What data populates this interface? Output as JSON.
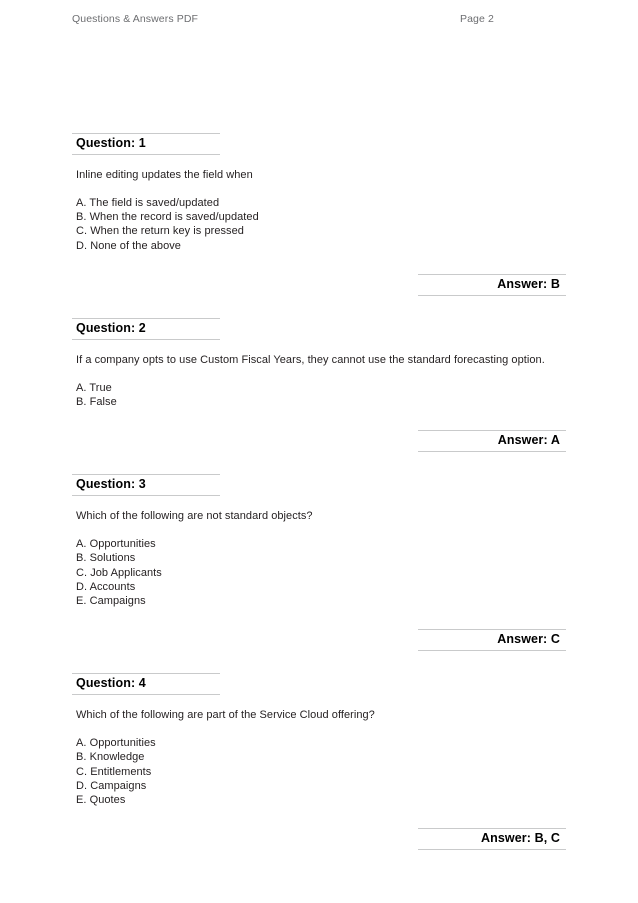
{
  "header": {
    "left_text": "Questions & Answers PDF",
    "right_text": "Page 2"
  },
  "questions": [
    {
      "heading": "Question: 1",
      "prompt": "Inline editing updates the field when",
      "options": [
        "A. The field is saved/updated",
        "B. When the record is saved/updated",
        "C. When the return key is pressed",
        "D. None of the above"
      ],
      "answer": "Answer: B"
    },
    {
      "heading": "Question: 2",
      "prompt": "If a company opts to use Custom Fiscal Years, they cannot use the standard forecasting option.",
      "options": [
        "A. True",
        "B. False"
      ],
      "answer": "Answer: A"
    },
    {
      "heading": "Question: 3",
      "prompt": "Which of the following are not standard objects?",
      "options": [
        "A. Opportunities",
        "B. Solutions",
        "C. Job Applicants",
        "D. Accounts",
        "E. Campaigns"
      ],
      "answer": "Answer: C"
    },
    {
      "heading": "Question: 4",
      "prompt": "Which of the following are part of the Service Cloud offering?",
      "options": [
        "A. Opportunities",
        "B. Knowledge",
        "C. Entitlements",
        "D. Campaigns",
        "E. Quotes"
      ],
      "answer": "Answer: B, C"
    }
  ],
  "colors": {
    "text": "#231f20",
    "header_text": "#6d6e71",
    "rule": "#c9cacb",
    "page_background": "#ffffff"
  }
}
